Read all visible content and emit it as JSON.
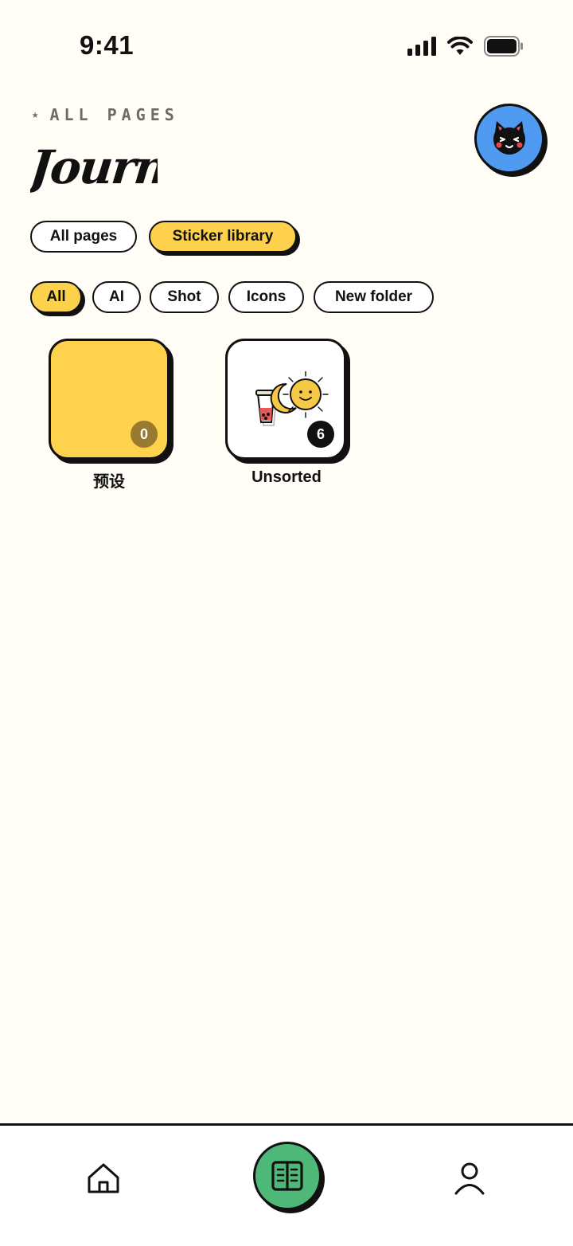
{
  "status_bar": {
    "time": "9:41",
    "icons": [
      "signal-icon",
      "wifi-icon",
      "battery-icon"
    ]
  },
  "header": {
    "eyebrow": "ALL PAGES",
    "title": "Journal",
    "avatar_icon": "black-cat-avatar-icon"
  },
  "tabs": [
    {
      "label": "All pages",
      "active": false
    },
    {
      "label": "Sticker library",
      "active": true
    }
  ],
  "filters": [
    {
      "label": "All",
      "active": true
    },
    {
      "label": "AI",
      "active": false
    },
    {
      "label": "Shot",
      "active": false
    },
    {
      "label": "Icons",
      "active": false
    },
    {
      "label": "New folder",
      "active": false
    }
  ],
  "folders": [
    {
      "name": "预设",
      "count": "0",
      "color": "#FFD24D"
    },
    {
      "name": "Unsorted",
      "count": "6",
      "color": "#FFFFFF",
      "preview_icons": [
        "boba-tea-sticker-icon",
        "moon-sticker-icon",
        "sun-sticker-icon"
      ]
    }
  ],
  "bottom_nav": {
    "items": [
      "home-icon",
      "journal-book-icon",
      "profile-icon"
    ],
    "active": "journal-book-icon"
  },
  "colors": {
    "background": "#FFFDF6",
    "accent_yellow": "#FDD14B",
    "avatar_blue": "#4F9BF1",
    "nav_green": "#4DB877",
    "ink": "#111111"
  }
}
